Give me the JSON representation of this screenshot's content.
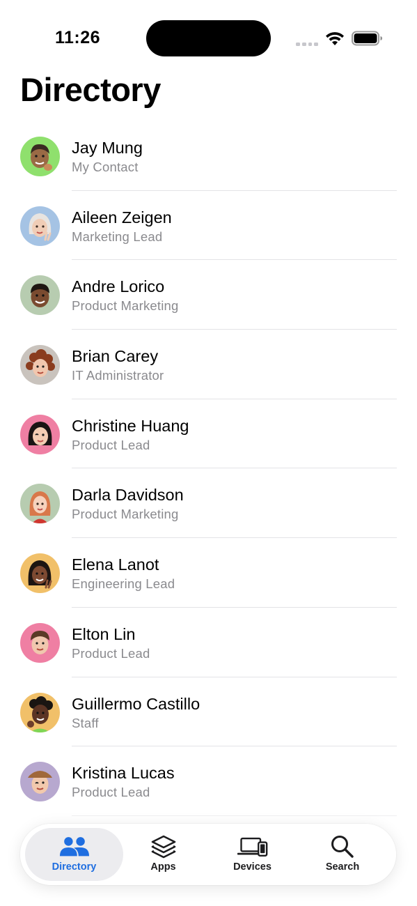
{
  "status_bar": {
    "time": "11:26"
  },
  "page_title": "Directory",
  "contacts": [
    {
      "name": "Jay Mung",
      "role": "My Contact",
      "avatar_bg": "#8fe06d",
      "avatar_icon": "memoji-thumbs-up-icon"
    },
    {
      "name": "Aileen Zeigen",
      "role": "Marketing Lead",
      "avatar_bg": "#a5c3e4",
      "avatar_icon": "memoji-peace-sign-icon"
    },
    {
      "name": "Andre Lorico",
      "role": "Product Marketing",
      "avatar_bg": "#b7ccb0",
      "avatar_icon": "memoji-smile-icon"
    },
    {
      "name": "Brian Carey",
      "role": "IT Administrator",
      "avatar_bg": "#c9c3bd",
      "avatar_icon": "memoji-curly-hair-icon"
    },
    {
      "name": "Christine Huang",
      "role": "Product Lead",
      "avatar_bg": "#ef7fa3",
      "avatar_icon": "memoji-wink-icon"
    },
    {
      "name": "Darla Davidson",
      "role": "Product Marketing",
      "avatar_bg": "#b7ccb0",
      "avatar_icon": "memoji-red-hair-icon"
    },
    {
      "name": "Elena Lanot",
      "role": "Engineering Lead",
      "avatar_bg": "#f1c069",
      "avatar_icon": "memoji-peace-sign-icon"
    },
    {
      "name": "Elton Lin",
      "role": "Product Lead",
      "avatar_bg": "#ef7fa3",
      "avatar_icon": "memoji-smile-icon"
    },
    {
      "name": "Guillermo Castillo",
      "role": "Staff",
      "avatar_bg": "#f1c069",
      "avatar_icon": "memoji-thumbs-up-icon"
    },
    {
      "name": "Kristina Lucas",
      "role": "Product Lead",
      "avatar_bg": "#b7a8cf",
      "avatar_icon": "memoji-wink-icon"
    }
  ],
  "tab_bar": {
    "tabs": [
      {
        "label": "Directory",
        "icon": "people-icon",
        "selected": true
      },
      {
        "label": "Apps",
        "icon": "stack-icon",
        "selected": false
      },
      {
        "label": "Devices",
        "icon": "laptop-phone-icon",
        "selected": false
      },
      {
        "label": "Search",
        "icon": "magnifying-glass-icon",
        "selected": false
      }
    ]
  },
  "colors": {
    "accent": "#1f6ee0",
    "secondary_text": "#8a8a8e",
    "divider": "#e3e3e6"
  }
}
